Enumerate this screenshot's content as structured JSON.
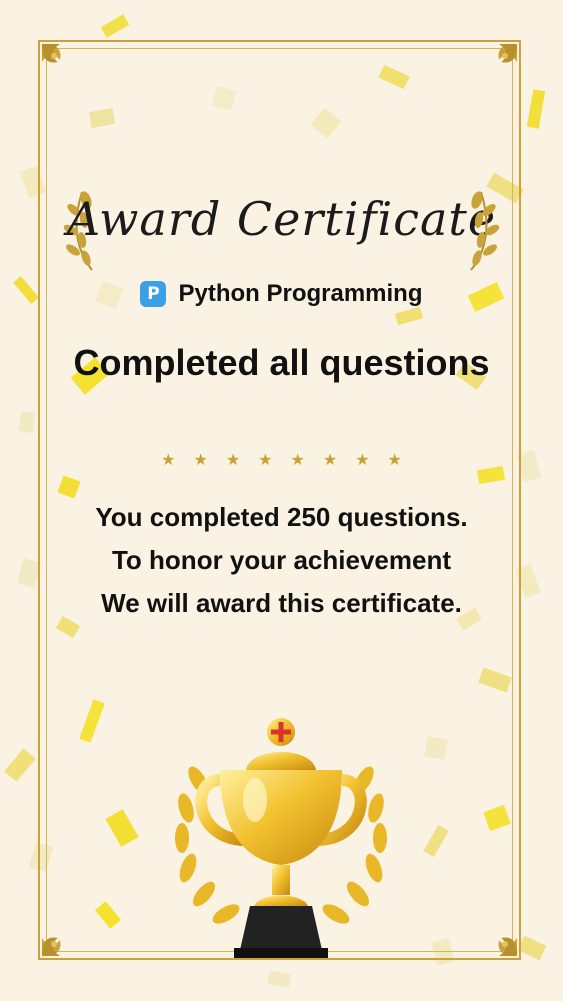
{
  "certificate": {
    "title": "Award Certificate",
    "course_icon_letter": "P",
    "course_name": "Python Programming",
    "headline": "Completed all questions",
    "stars": [
      "★",
      "★",
      "★",
      "★",
      "★",
      "★",
      "★",
      "★"
    ],
    "message_lines": [
      "You completed 250 questions.",
      "To honor your achievement",
      "We will award this certificate."
    ]
  },
  "colors": {
    "background": "#faf3e3",
    "gold": "#c9a23a",
    "confetti": "#f5e05a",
    "badge": "#3aa0e8"
  },
  "icons": {
    "course": "python-badge-icon",
    "trophy": "trophy-icon",
    "laurel": "laurel-icon",
    "star": "star-icon"
  }
}
